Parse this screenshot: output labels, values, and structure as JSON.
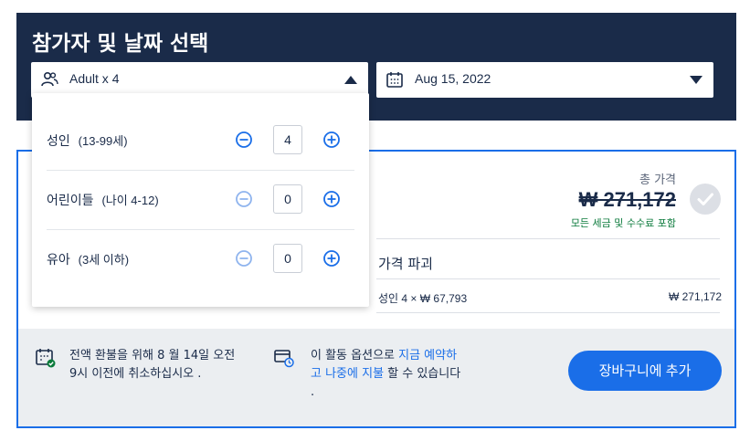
{
  "header": {
    "title": "참가자 및 날짜 선택",
    "participants_value": "Adult x 4",
    "date_value": "Aug 15, 2022"
  },
  "participants": [
    {
      "label": "성인",
      "range": "(13-99세)",
      "count": "4",
      "minus_enabled": true
    },
    {
      "label": "어린이들",
      "range": "(나이 4-12)",
      "count": "0",
      "minus_enabled": false
    },
    {
      "label": "유아",
      "range": "(3세 이하)",
      "count": "0",
      "minus_enabled": false
    }
  ],
  "price": {
    "label": "총 가격",
    "value": "₩ 271,172",
    "note": "모든 세금 및 수수료 포함"
  },
  "breakdown": {
    "title": "가격 파괴",
    "row_label": "성인 4 × ₩ 67,793",
    "row_total": "₩ 271,172"
  },
  "footer": {
    "cancel_line1": "전액 환불을 위해 8 월 14일 오전",
    "cancel_line2": "9시 이전에 취소하십시오 .",
    "pay_prefix": "이 활동 옵션으로 ",
    "pay_link1": "지금 예약하",
    "pay_link2": "고 나중에 지불",
    "pay_suffix": " 할 수 있습니다",
    "pay_end": ".",
    "cart_button": "장바구니에 추가"
  },
  "colors": {
    "navy": "#1a2b49",
    "accent_blue": "#1a6ee8",
    "green": "#0a7a3b",
    "disabled": "#8fb4ee"
  },
  "icons": [
    "people-icon",
    "calendar-icon",
    "minus-circle-icon",
    "plus-circle-icon",
    "check-icon",
    "calendar-check-icon",
    "card-clock-icon"
  ]
}
